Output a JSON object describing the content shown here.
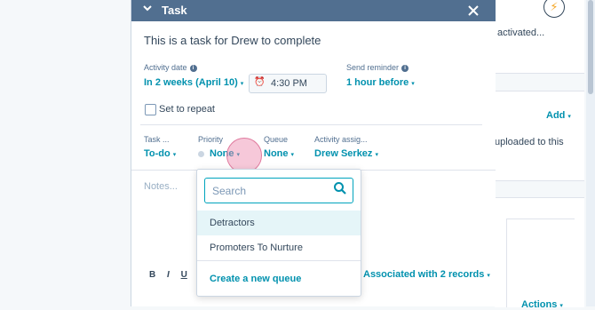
{
  "background": {
    "activated_text": "activated...",
    "add_link": "Add",
    "uploaded_text": "uploaded to this",
    "actions_link": "Actions"
  },
  "task_panel": {
    "header_title": "Task",
    "task_title": "This is a task for Drew to complete",
    "activity_date_label": "Activity date",
    "activity_date_value": "In 2 weeks (April 10)",
    "time_value": "4:30 PM",
    "send_reminder_label": "Send reminder",
    "send_reminder_value": "1 hour before",
    "set_to_repeat_label": "Set to repeat",
    "task_type_label": "Task ...",
    "task_type_value": "To-do",
    "priority_label": "Priority",
    "priority_value": "None",
    "queue_label": "Queue",
    "queue_value": "None",
    "assigned_label": "Activity assig...",
    "assigned_value": "Drew Serkez",
    "notes_placeholder": "Notes...",
    "toolbar": {
      "bold": "B",
      "italic": "I",
      "underline": "U"
    },
    "associated_value": "Associated with 2 records"
  },
  "queue_dropdown": {
    "search_placeholder": "Search",
    "options": [
      "Detractors",
      "Promoters To Nurture"
    ],
    "create_label": "Create a new queue"
  },
  "colors": {
    "header_bg": "#516f90",
    "link": "#0091ae",
    "search_border": "#00a4bd",
    "highlight": "#e5f5f8"
  }
}
